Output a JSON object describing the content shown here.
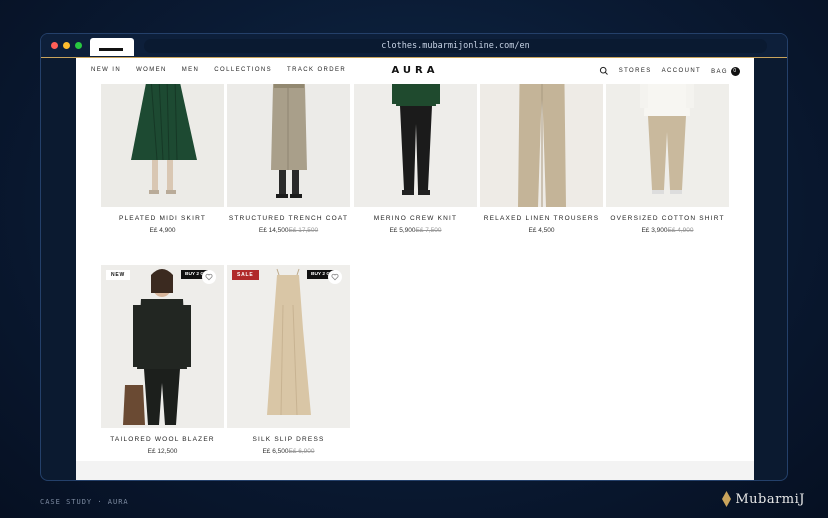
{
  "browser": {
    "url": "clothes.mubarmijonline.com/en"
  },
  "nav": {
    "links": [
      "NEW IN",
      "WOMEN",
      "MEN",
      "COLLECTIONS",
      "TRACK ORDER"
    ],
    "logo": "AURA",
    "stores": "STORES",
    "account": "ACCOUNT",
    "bag_label": "BAG",
    "bag_count": "0"
  },
  "products": [
    {
      "name": "PLEATED MIDI SKIRT",
      "price": "E£ 4,900",
      "old_price": ""
    },
    {
      "name": "STRUCTURED TRENCH COAT",
      "price": "E£ 14,500",
      "old_price": "E£ 17,500"
    },
    {
      "name": "MERINO CREW KNIT",
      "price": "E£ 5,900",
      "old_price": "E£ 7,500"
    },
    {
      "name": "RELAXED LINEN TROUSERS",
      "price": "E£ 4,500",
      "old_price": ""
    },
    {
      "name": "OVERSIZED COTTON SHIRT",
      "price": "E£ 3,900",
      "old_price": "E£ 4,900"
    },
    {
      "name": "TAILORED WOOL BLAZER",
      "price": "E£ 12,500",
      "old_price": "",
      "badge": "NEW",
      "buy_tag": "BUY 2 G"
    },
    {
      "name": "SILK SLIP DRESS",
      "price": "E£ 6,500",
      "old_price": "E£ 6,900",
      "badge": "SALE",
      "buy_tag": "BUY 2 G"
    }
  ],
  "caption": "CASE STUDY · AURA",
  "brand": "MubarmiJ",
  "colors": {
    "background": "#0a1a33",
    "accent": "#c9a45c",
    "sale": "#b02a2a"
  }
}
